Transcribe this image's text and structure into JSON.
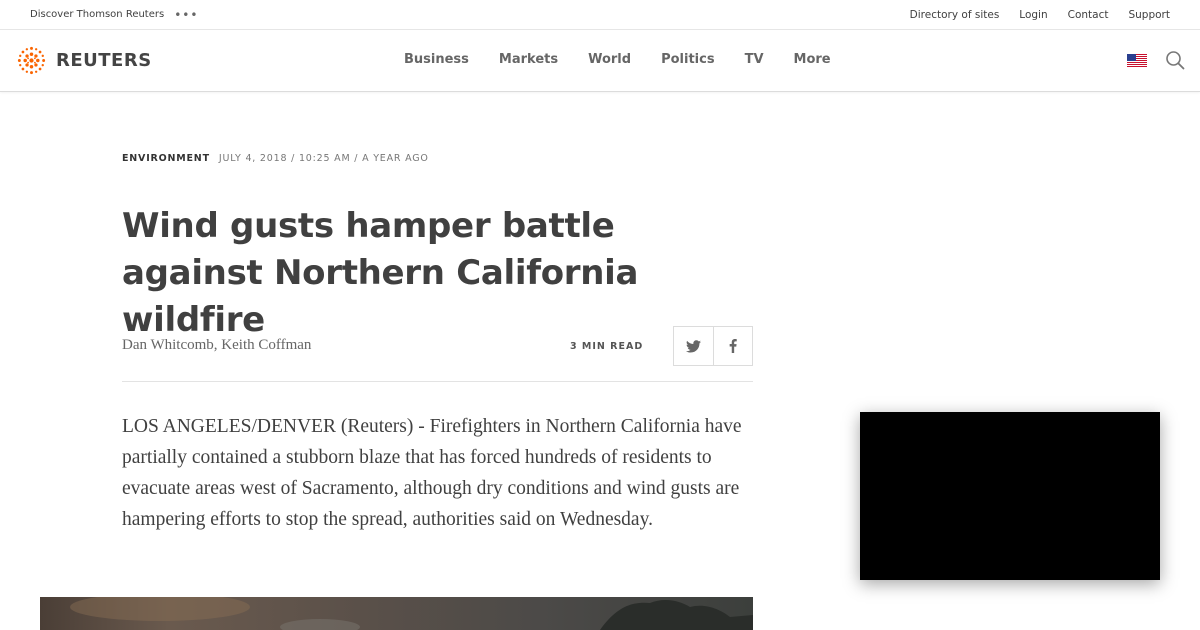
{
  "utility_bar": {
    "discover_label": "Discover Thomson Reuters",
    "more_dots": "•••",
    "links": [
      "Directory of sites",
      "Login",
      "Contact",
      "Support"
    ]
  },
  "header": {
    "logo_text": "REUTERS",
    "logo_color": "#fa6400",
    "nav": [
      "Business",
      "Markets",
      "World",
      "Politics",
      "TV",
      "More"
    ],
    "flag_icon": "us-flag-icon",
    "search_icon": "search-icon"
  },
  "article": {
    "section": "ENVIRONMENT",
    "date": "JULY 4, 2018 / 10:25 AM / A YEAR AGO",
    "headline": "Wind gusts hamper battle against Northern California wildfire",
    "byline": "Dan Whitcomb, Keith Coffman",
    "read_time": "3 MIN READ",
    "share_icons": [
      "twitter-icon",
      "facebook-icon"
    ],
    "body": "LOS ANGELES/DENVER (Reuters) - Firefighters in Northern California have partially contained a stubborn blaze that has forced hundreds of residents to evacuate areas west of Sacramento, although dry conditions and wind gusts are hampering efforts to stop the spread, authorities said on Wednesday."
  }
}
